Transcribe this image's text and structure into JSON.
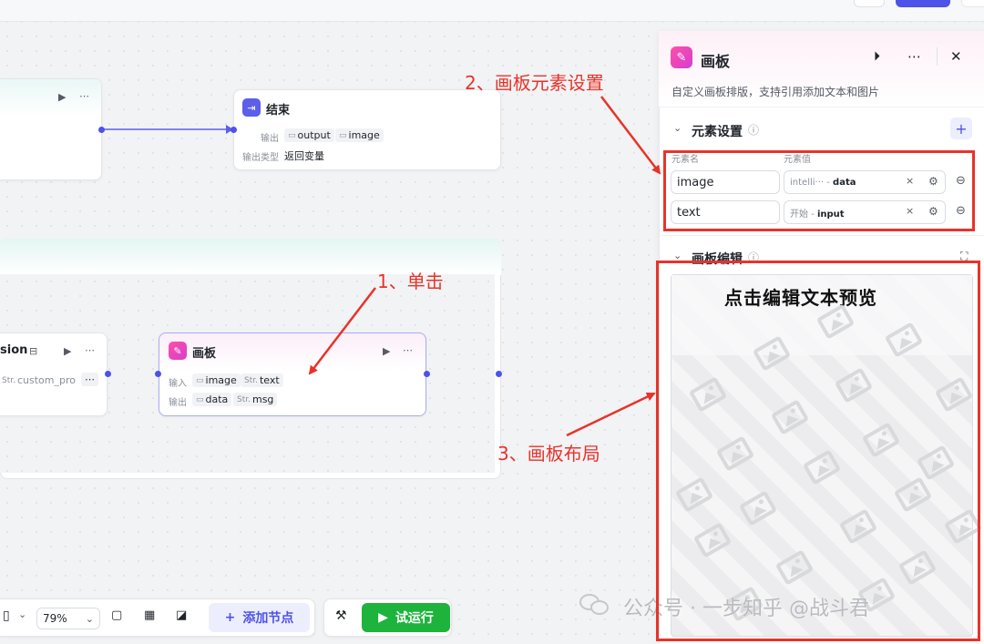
{
  "top_node": {
    "actions": [
      "▶",
      "⋯"
    ]
  },
  "end_node": {
    "title": "结束",
    "output_label": "输出",
    "outputs": [
      "output",
      "image"
    ],
    "output_type_label": "输出类型",
    "output_type_value": "返回变量"
  },
  "session_node": {
    "title": "sion",
    "input": "custom_pro",
    "more": "⋯"
  },
  "board_node": {
    "title": "画板",
    "input_label": "输入",
    "inputs": [
      {
        "type": "img",
        "name": "image"
      },
      {
        "type": "Str.",
        "name": "text"
      }
    ],
    "output_label": "输出",
    "outputs": [
      {
        "type": "img",
        "name": "data"
      },
      {
        "type": "Str.",
        "name": "msg"
      }
    ]
  },
  "panel": {
    "title": "画板",
    "description": "自定义画板排版，支持引用添加文本和图片",
    "element_section": "元素设置",
    "col_name": "元素名",
    "col_value": "元素值",
    "elements": [
      {
        "name": "image",
        "source": "intelli···",
        "var": "data"
      },
      {
        "name": "text",
        "source": "开始",
        "var": "input"
      }
    ],
    "edit_section": "画板编辑",
    "preview_text": "点击编辑文本预览"
  },
  "toolbar": {
    "zoom": "79%",
    "add_node": "添加节点",
    "test_run": "试运行"
  },
  "annotations": {
    "a1": "1、单击",
    "a2": "2、画板元素设置",
    "a3": "3、画板布局"
  },
  "watermark": "公众号 · 一步知乎 @战斗君",
  "colors": {
    "primary": "#4d53e8",
    "run_green": "#1db33c",
    "annotation_red": "#e8332a",
    "board_pink": "#ff4fa7"
  }
}
